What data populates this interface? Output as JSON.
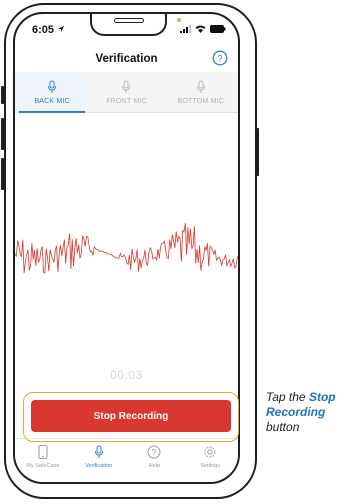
{
  "status_bar": {
    "time": "6:05"
  },
  "nav": {
    "title": "Verification"
  },
  "tabs": [
    {
      "label": "BACK MIC",
      "active": true
    },
    {
      "label": "FRONT MIC",
      "active": false
    },
    {
      "label": "BOTTOM MIC",
      "active": false
    }
  ],
  "recording": {
    "timer": "00:03",
    "button_label": "Stop Recording"
  },
  "bottom_nav": [
    {
      "label": "My SafeCase",
      "icon": "phone-icon"
    },
    {
      "label": "Verification",
      "icon": "microphone-icon",
      "active": true
    },
    {
      "label": "Help",
      "icon": "help-icon"
    },
    {
      "label": "Settings",
      "icon": "gear-icon"
    }
  ],
  "callout": {
    "prefix": "Tap the ",
    "emphasis_1": "Stop",
    "emphasis_2": "Recording",
    "suffix": "button"
  },
  "colors": {
    "accent": "#3a7fbd",
    "stop_button": "#d8382f",
    "waveform": "#d8382f",
    "highlight": "#f2a33a",
    "callout_emphasis": "#1f74b8"
  }
}
